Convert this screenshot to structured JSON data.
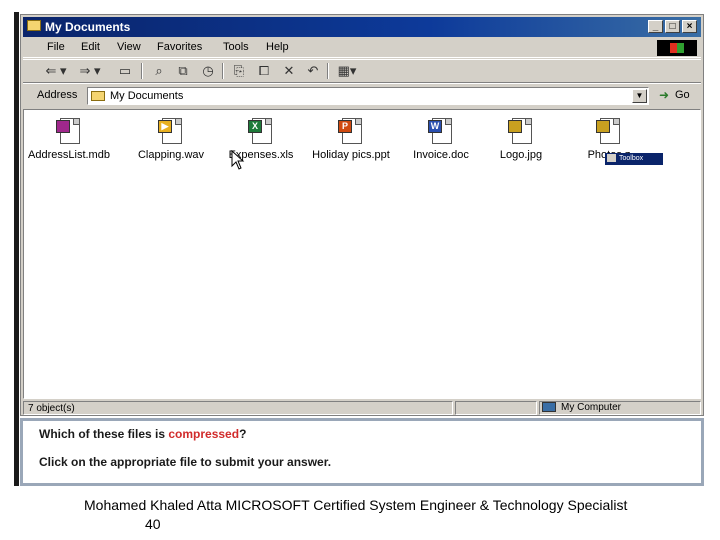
{
  "window": {
    "title": "My Documents",
    "buttons": [
      "_",
      "□",
      "×"
    ]
  },
  "menu": [
    "File",
    "Edit",
    "View",
    "Favorites",
    "Tools",
    "Help"
  ],
  "toolbar": {
    "buttons": [
      "back-icon",
      "forward-icon",
      "up-folder-icon",
      "search-icon",
      "folders-icon",
      "history-icon",
      "move-to-icon",
      "copy-to-icon",
      "delete-icon",
      "undo-icon",
      "views-icon"
    ]
  },
  "address": {
    "label": "Address",
    "value": "My Documents",
    "go": "Go"
  },
  "files": [
    {
      "name": "AddressList.mdb",
      "icon": "access-file-icon",
      "color": "#a0288c",
      "letter": ""
    },
    {
      "name": "Clapping.wav",
      "icon": "sound-file-icon",
      "color": "#e8b020",
      "letter": "▶"
    },
    {
      "name": "Expenses.xls",
      "icon": "excel-file-icon",
      "color": "#1e7a3a",
      "letter": "X"
    },
    {
      "name": "Holiday pics.ppt",
      "icon": "powerpoint-file-icon",
      "color": "#d04a10",
      "letter": "P"
    },
    {
      "name": "Invoice.doc",
      "icon": "word-file-icon",
      "color": "#2a4fb0",
      "letter": "W"
    },
    {
      "name": "Logo.jpg",
      "icon": "image-file-icon",
      "color": "#c8a020",
      "letter": ""
    },
    {
      "name": "Photos.z",
      "icon": "zip-file-icon",
      "color": "#c8a020",
      "letter": ""
    }
  ],
  "tooltip": "Toolbox",
  "status": {
    "count": "7 object(s)",
    "location": "My Computer"
  },
  "question": {
    "prefix": "Which of these files is ",
    "highlight": "compressed",
    "suffix": "?",
    "instruction": "Click on the appropriate file to submit your answer."
  },
  "footer": {
    "text": "Mohamed Khaled Atta MICROSOFT Certified System Engineer & Technology Specialist",
    "page": "40"
  }
}
